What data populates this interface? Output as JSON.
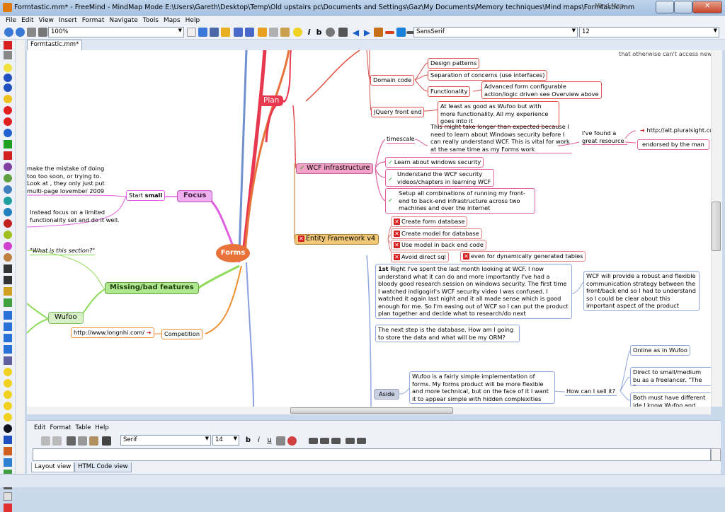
{
  "window": {
    "title": "Formtastic.mm* - FreeMind - MindMap Mode E:\\Users\\Gareth\\Desktop\\Temp\\Old upstairs pc\\Documents and Settings\\Gaz\\My Documents\\Memory techniques\\Mind maps\\Formtastic.mm",
    "corner_hint": "Mind Map..."
  },
  "menu": [
    "File",
    "Edit",
    "View",
    "Insert",
    "Format",
    "Navigate",
    "Tools",
    "Maps",
    "Help"
  ],
  "toolbar": {
    "zoom": "100%",
    "font": "SansSerif",
    "size": "12"
  },
  "tab": {
    "label": "Formtastic.mm*"
  },
  "map": {
    "root": "Forms",
    "plan": "Plan",
    "domain_code": "Domain code",
    "design_patterns": "Design patterns",
    "separation": "Separation of concerns (use interfaces)",
    "functionality": "Functionality",
    "functionality_note": "Advanced form configurable action/logic driven see Overview above",
    "jquery": "JQuery front end",
    "jquery_note": "At least as good as Wufoo but with more functionality. All my experience goes into it",
    "top_right_fragment": "that otherwise can't access new",
    "timescale": "timescale",
    "timescale_note": "This might take longer than expected because I need to learn about Windows security before I can really understand WCF. This is vital for work at the same time as my Forms work",
    "great_resource": "I've found a great resource",
    "pluralsight": "http://alt.pluralsight.com",
    "endorsed": "endorsed by the man",
    "wcf": "WCF infrastructure",
    "learn_security": "Learn about windows security",
    "understand_wcf": "Understand the WCF security videos/chapters in learning WCF",
    "setup_all": "Setup all combinations of running my front-end to back-end infrastructure across two machines and over the internet",
    "ef": "Entity Framework v4",
    "create_form_db": "Create form database",
    "create_model": "Create model for database",
    "use_model": "Use model in back end code",
    "avoid_sql": "Avoid direct sql",
    "even_dynamic": "even for dynamically generated tables",
    "note_1st_bold": "1st",
    "note_1st": " Right I've spent the last month looking at WCF. I now understand what it can do and more importantly I've had a bloody good research session on windows security. The first time I watched indigogirl's WCF security video I was confused. I watched it again last night and it all made sense which is good enough for me. So I'm easing out of WCF so I can put the product plan together and decide what to research/do next",
    "wcf_robust": "WCF will provide a robust and flexible communication strategy between the front/back end so I had to understand so I could be clear about this important aspect of the product",
    "next_step": "The next step is the database. How am I going to store the data and what will be my ORM?",
    "aside": "Aside",
    "aside_note": "Wufoo is a fairly simple implementation of forms. My forms product will be more flexible and more technical, but on the face of it I want it to appear simple with hidden complexities",
    "how_sell": "How can I sell it?",
    "online_wufoo": "Online as in Wufoo",
    "direct_small": "Direct to small/medium bu as a freelancer. \"The Form",
    "both_must": "Both must have different ide I know Wufoo and Perfect F",
    "focus": "Focus",
    "start_small_a": "Start ",
    "start_small_b": "small",
    "mistake": "make the mistake of doing too too soon, or trying to. Look at , they only just put multi-page lovember 2009",
    "instead": "Instead focus on a limited functionality set and do it well.",
    "missing": "Missing/bad features",
    "what_section": "\"What is this section?\"",
    "wufoo": "Wufoo",
    "competition": "Competition",
    "longnhi": "http://www.longnhi.com/"
  },
  "notes_panel": {
    "menu": [
      "Edit",
      "Format",
      "Table",
      "Help"
    ],
    "font": "Serif",
    "size": "14",
    "tabs": [
      "Layout view",
      "HTML Code view"
    ]
  },
  "colors": {
    "plan": "#e8384f",
    "wcf": "#f4a3c8",
    "ef": "#f0c878",
    "focus": "#e060e0",
    "missing": "#8fdc5c",
    "root": "#e8723a"
  }
}
